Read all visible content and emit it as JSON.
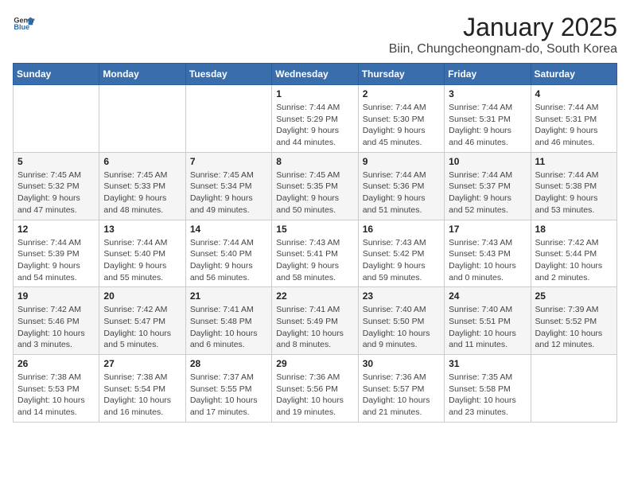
{
  "logo": {
    "line1": "General",
    "line2": "Blue"
  },
  "title": "January 2025",
  "location": "Biin, Chungcheongnam-do, South Korea",
  "weekdays": [
    "Sunday",
    "Monday",
    "Tuesday",
    "Wednesday",
    "Thursday",
    "Friday",
    "Saturday"
  ],
  "weeks": [
    [
      {
        "day": "",
        "info": ""
      },
      {
        "day": "",
        "info": ""
      },
      {
        "day": "",
        "info": ""
      },
      {
        "day": "1",
        "info": "Sunrise: 7:44 AM\nSunset: 5:29 PM\nDaylight: 9 hours\nand 44 minutes."
      },
      {
        "day": "2",
        "info": "Sunrise: 7:44 AM\nSunset: 5:30 PM\nDaylight: 9 hours\nand 45 minutes."
      },
      {
        "day": "3",
        "info": "Sunrise: 7:44 AM\nSunset: 5:31 PM\nDaylight: 9 hours\nand 46 minutes."
      },
      {
        "day": "4",
        "info": "Sunrise: 7:44 AM\nSunset: 5:31 PM\nDaylight: 9 hours\nand 46 minutes."
      }
    ],
    [
      {
        "day": "5",
        "info": "Sunrise: 7:45 AM\nSunset: 5:32 PM\nDaylight: 9 hours\nand 47 minutes."
      },
      {
        "day": "6",
        "info": "Sunrise: 7:45 AM\nSunset: 5:33 PM\nDaylight: 9 hours\nand 48 minutes."
      },
      {
        "day": "7",
        "info": "Sunrise: 7:45 AM\nSunset: 5:34 PM\nDaylight: 9 hours\nand 49 minutes."
      },
      {
        "day": "8",
        "info": "Sunrise: 7:45 AM\nSunset: 5:35 PM\nDaylight: 9 hours\nand 50 minutes."
      },
      {
        "day": "9",
        "info": "Sunrise: 7:44 AM\nSunset: 5:36 PM\nDaylight: 9 hours\nand 51 minutes."
      },
      {
        "day": "10",
        "info": "Sunrise: 7:44 AM\nSunset: 5:37 PM\nDaylight: 9 hours\nand 52 minutes."
      },
      {
        "day": "11",
        "info": "Sunrise: 7:44 AM\nSunset: 5:38 PM\nDaylight: 9 hours\nand 53 minutes."
      }
    ],
    [
      {
        "day": "12",
        "info": "Sunrise: 7:44 AM\nSunset: 5:39 PM\nDaylight: 9 hours\nand 54 minutes."
      },
      {
        "day": "13",
        "info": "Sunrise: 7:44 AM\nSunset: 5:40 PM\nDaylight: 9 hours\nand 55 minutes."
      },
      {
        "day": "14",
        "info": "Sunrise: 7:44 AM\nSunset: 5:40 PM\nDaylight: 9 hours\nand 56 minutes."
      },
      {
        "day": "15",
        "info": "Sunrise: 7:43 AM\nSunset: 5:41 PM\nDaylight: 9 hours\nand 58 minutes."
      },
      {
        "day": "16",
        "info": "Sunrise: 7:43 AM\nSunset: 5:42 PM\nDaylight: 9 hours\nand 59 minutes."
      },
      {
        "day": "17",
        "info": "Sunrise: 7:43 AM\nSunset: 5:43 PM\nDaylight: 10 hours\nand 0 minutes."
      },
      {
        "day": "18",
        "info": "Sunrise: 7:42 AM\nSunset: 5:44 PM\nDaylight: 10 hours\nand 2 minutes."
      }
    ],
    [
      {
        "day": "19",
        "info": "Sunrise: 7:42 AM\nSunset: 5:46 PM\nDaylight: 10 hours\nand 3 minutes."
      },
      {
        "day": "20",
        "info": "Sunrise: 7:42 AM\nSunset: 5:47 PM\nDaylight: 10 hours\nand 5 minutes."
      },
      {
        "day": "21",
        "info": "Sunrise: 7:41 AM\nSunset: 5:48 PM\nDaylight: 10 hours\nand 6 minutes."
      },
      {
        "day": "22",
        "info": "Sunrise: 7:41 AM\nSunset: 5:49 PM\nDaylight: 10 hours\nand 8 minutes."
      },
      {
        "day": "23",
        "info": "Sunrise: 7:40 AM\nSunset: 5:50 PM\nDaylight: 10 hours\nand 9 minutes."
      },
      {
        "day": "24",
        "info": "Sunrise: 7:40 AM\nSunset: 5:51 PM\nDaylight: 10 hours\nand 11 minutes."
      },
      {
        "day": "25",
        "info": "Sunrise: 7:39 AM\nSunset: 5:52 PM\nDaylight: 10 hours\nand 12 minutes."
      }
    ],
    [
      {
        "day": "26",
        "info": "Sunrise: 7:38 AM\nSunset: 5:53 PM\nDaylight: 10 hours\nand 14 minutes."
      },
      {
        "day": "27",
        "info": "Sunrise: 7:38 AM\nSunset: 5:54 PM\nDaylight: 10 hours\nand 16 minutes."
      },
      {
        "day": "28",
        "info": "Sunrise: 7:37 AM\nSunset: 5:55 PM\nDaylight: 10 hours\nand 17 minutes."
      },
      {
        "day": "29",
        "info": "Sunrise: 7:36 AM\nSunset: 5:56 PM\nDaylight: 10 hours\nand 19 minutes."
      },
      {
        "day": "30",
        "info": "Sunrise: 7:36 AM\nSunset: 5:57 PM\nDaylight: 10 hours\nand 21 minutes."
      },
      {
        "day": "31",
        "info": "Sunrise: 7:35 AM\nSunset: 5:58 PM\nDaylight: 10 hours\nand 23 minutes."
      },
      {
        "day": "",
        "info": ""
      }
    ]
  ]
}
